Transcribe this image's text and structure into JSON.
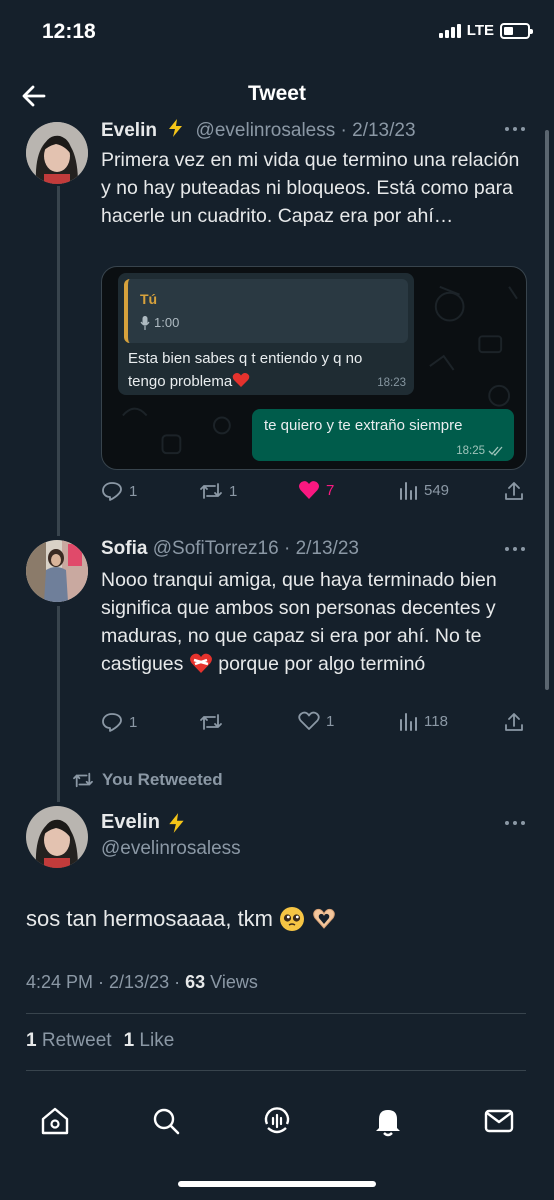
{
  "status_bar": {
    "time": "12:18",
    "network": "LTE"
  },
  "header": {
    "title": "Tweet",
    "back_icon": "arrow-left-icon"
  },
  "tweets": [
    {
      "name": "Evelin",
      "badge_icon": "lightning-emoji",
      "handle": "@evelinrosaless",
      "date": "· 2/13/23",
      "text": "Primera vez en mi vida que termino una relación y no hay puteadas ni bloqueos. Está como para hacerle un cuadrito. Capaz era por ahí…",
      "media": {
        "quoted_name": "Tú",
        "quoted_audio": "1:00",
        "incoming_text": "Esta bien sabes q t entiendo y q no tengo problema",
        "incoming_time": "18:23",
        "outgoing_text": "te quiero y te extraño siempre",
        "outgoing_time": "18:25"
      },
      "replies": "1",
      "retweets": "1",
      "likes": "7",
      "views": "549"
    },
    {
      "name": "Sofia",
      "handle": "@SofiTorrez16",
      "date": "· 2/13/23",
      "text_before_emoji": "Nooo tranqui amiga, que haya terminado bien significa que ambos son personas decentes y maduras, no que capaz si era por ahí. No te castigues",
      "text_after_emoji": "porque por algo terminó",
      "replies": "1",
      "retweets": "",
      "likes": "1",
      "views": "118"
    }
  ],
  "retweeted_label": "You Retweeted",
  "main_tweet": {
    "name": "Evelin",
    "handle": "@evelinrosaless",
    "text": "sos tan hermosaaaa, tkm",
    "time": "4:24 PM · 2/13/23 ·",
    "views_count": "63",
    "views_label": "Views",
    "retweet_count": "1",
    "retweet_label": "Retweet",
    "like_count": "1",
    "like_label": "Like"
  },
  "tabbar": [
    "home-icon",
    "search-icon",
    "spaces-icon",
    "notifications-icon",
    "messages-icon"
  ],
  "colors": {
    "background": "#15202b",
    "like": "#f91880",
    "whatsapp_out": "#005c4b",
    "whatsapp_quote": "#d7a23c"
  }
}
